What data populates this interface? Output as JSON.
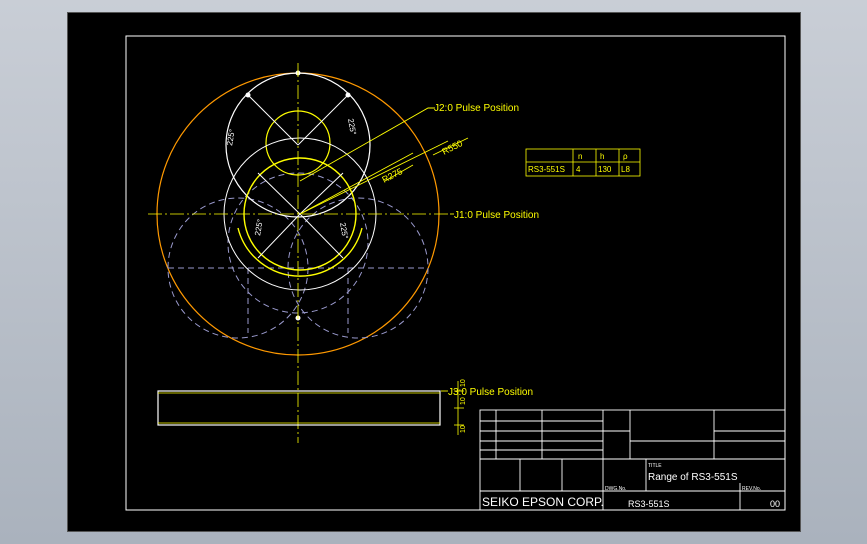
{
  "drawing": {
    "labels": {
      "j2_pulse": "J2:0 Pulse Position",
      "j1_pulse": "J1:0 Pulse Position",
      "j3_pulse": "J3:0 Pulse Position",
      "r550": "R550",
      "r275": "R275",
      "angle_upper_left": "225°",
      "angle_upper_right": "225°",
      "angle_lower_left": "225°",
      "angle_lower_right": "225°"
    },
    "colors": {
      "outer_arc": "#ff9900",
      "primary": "#ffff00",
      "white": "#ffffff",
      "dashed": "#9999cc"
    }
  },
  "spec_table": {
    "headers": [
      "",
      "n",
      "h",
      "ρ"
    ],
    "row": [
      "RS3-551S",
      "4",
      "130",
      "L8"
    ]
  },
  "title_block": {
    "title_label": "TITLE",
    "title": "Range of RS3-551S",
    "dwg_no_label": "DWG.No.",
    "dwg_no": "RS3-551S",
    "rev_label": "REV.No.",
    "rev": "00",
    "company": "SEIKO EPSON CORP."
  },
  "side_view": {
    "dims": [
      "10",
      "10",
      "10"
    ]
  }
}
